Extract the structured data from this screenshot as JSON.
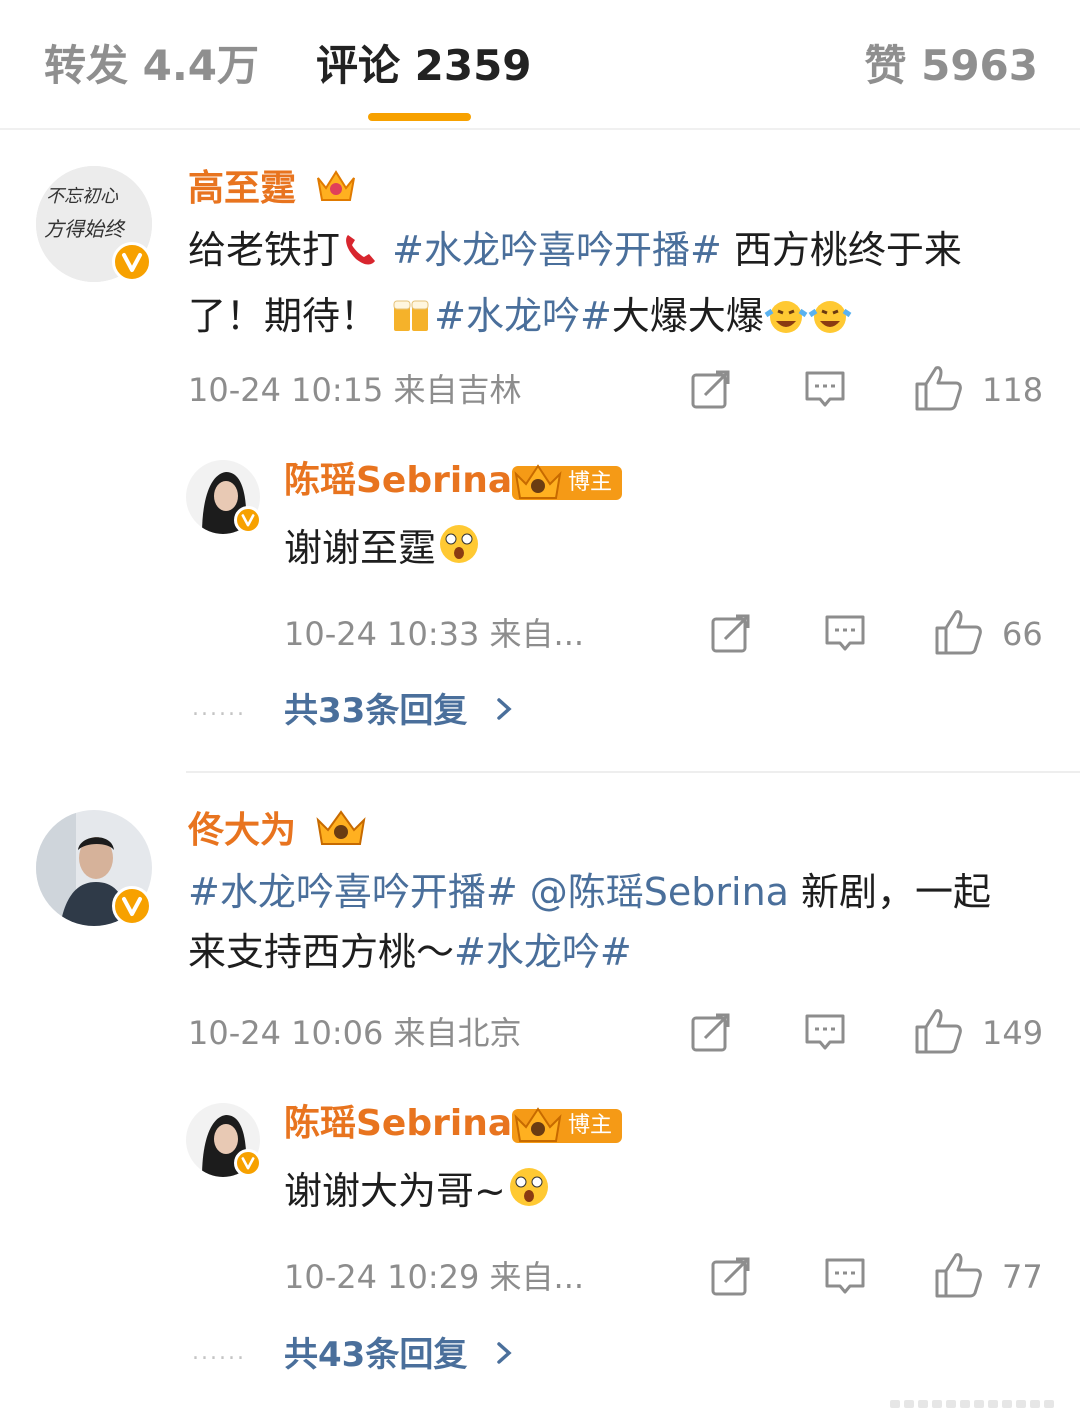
{
  "tabs": {
    "repost": "转发 4.4万",
    "comment": "评论 2359",
    "like": "赞 5963",
    "accent": "#f7a100"
  },
  "comments": [
    {
      "user": "高至霆",
      "avatar_text": [
        "不忘初心",
        "方得始终"
      ],
      "body": {
        "p1": "给老铁打",
        "t1": "#水龙吟喜吟开播#",
        "p2": " 西方桃终于来了！期待！",
        "t2": "#水龙吟#",
        "p3": "大爆大爆"
      },
      "time": "10-24 10:15",
      "location": "来自吉林",
      "likes": "118",
      "reply": {
        "user": "陈瑶Sebrina",
        "badge": "博主",
        "text": "谢谢至霆",
        "time": "10-24 10:33",
        "location": "来自...",
        "likes": "66"
      },
      "more_replies": "共33条回复"
    },
    {
      "user": "佟大为",
      "body": {
        "t1": "#水龙吟喜吟开播#",
        "mention": "@陈瑶Sebrina",
        "p1": " 新剧，一起来支持西方桃～",
        "t2": "#水龙吟#"
      },
      "time": "10-24 10:06",
      "location": "来自北京",
      "likes": "149",
      "reply": {
        "user": "陈瑶Sebrina",
        "badge": "博主",
        "text": "谢谢大为哥~",
        "time": "10-24 10:29",
        "location": "来自...",
        "likes": "77"
      },
      "more_replies": "共43条回复"
    }
  ],
  "colors": {
    "username": "#e8741f",
    "topic_link": "#4a6f9b",
    "meta": "#8d8d8d",
    "verified": "#f7a100"
  },
  "icons": [
    "repost-icon",
    "comment-icon",
    "thumb-up-icon",
    "chevron-right-icon",
    "verified-v-icon",
    "crown-icon",
    "phone-icon",
    "beer-icon",
    "laugh-cry-icon",
    "shocked-face-icon"
  ]
}
